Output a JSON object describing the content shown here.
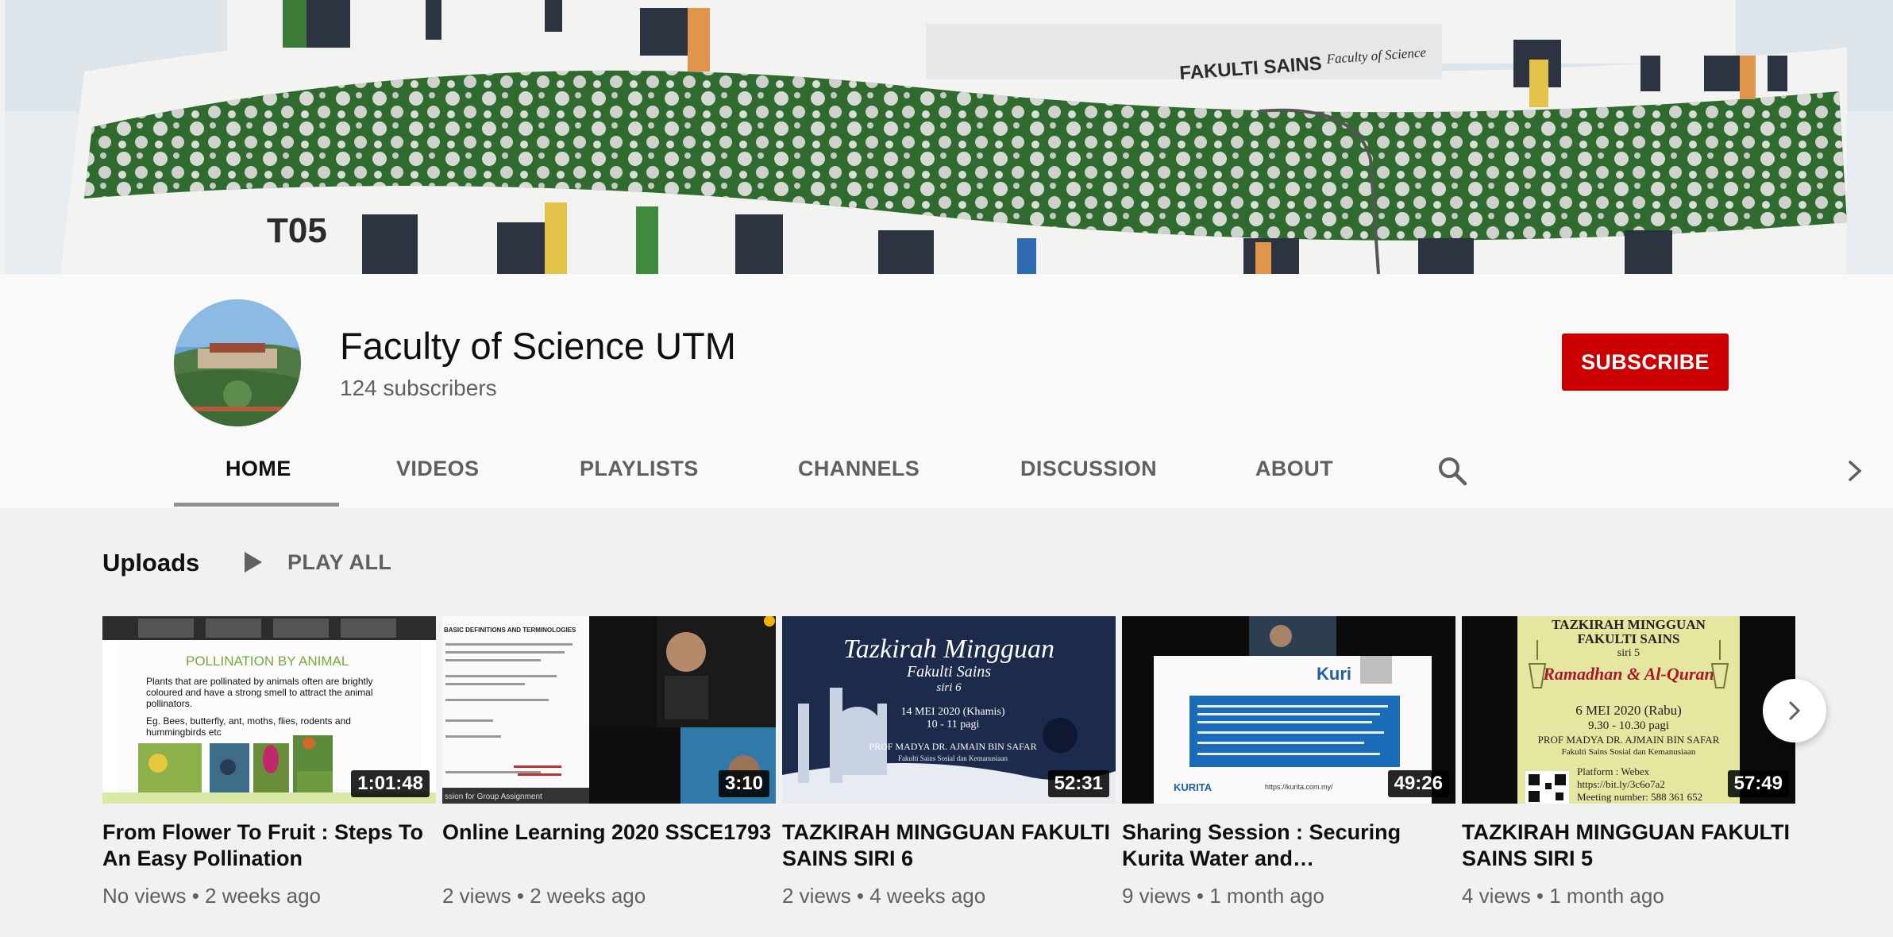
{
  "banner": {
    "building_code": "T05",
    "sign_text": "FAKULTI SAINS  Faculty of Science"
  },
  "channel": {
    "name": "Faculty of Science UTM",
    "subscribers": "124 subscribers",
    "subscribe_label": "SUBSCRIBE"
  },
  "tabs": [
    {
      "label": "HOME",
      "active": true
    },
    {
      "label": "VIDEOS",
      "active": false
    },
    {
      "label": "PLAYLISTS",
      "active": false
    },
    {
      "label": "CHANNELS",
      "active": false
    },
    {
      "label": "DISCUSSION",
      "active": false
    },
    {
      "label": "ABOUT",
      "active": false
    }
  ],
  "icons": {
    "search": "search-icon",
    "tabs_next": "chevron-right-icon",
    "play": "play-icon",
    "carousel_next": "chevron-right-icon"
  },
  "uploads": {
    "title": "Uploads",
    "play_all_label": "PLAY ALL",
    "videos": [
      {
        "title": "From Flower To Fruit : Steps To An Easy Pollination",
        "meta": "No views • 2 weeks ago",
        "duration": "1:01:48",
        "thumb_text": {
          "heading": "POLLINATION BY ANIMAL",
          "b1": "Plants that are pollinated by animals often are brightly",
          "b1b": "coloured and have a strong smell to attract the animal",
          "b1c": "pollinators.",
          "b2": "Eg. Bees, butterfly, ant, moths, flies, rodents and",
          "b2b": "hummingbirds etc"
        }
      },
      {
        "title": "Online Learning 2020 SSCE1793",
        "meta": "2 views • 2 weeks ago",
        "duration": "3:10",
        "thumb_text": {
          "heading": "BASIC DEFINITIONS AND TERMINOLOGIES",
          "footer": "ssion for Group Assignment"
        }
      },
      {
        "title": "TAZKIRAH MINGGUAN FAKULTI SAINS SIRI 6",
        "meta": "2 views • 4 weeks ago",
        "duration": "52:31",
        "thumb_text": {
          "l1": "Tazkirah Mingguan",
          "l2": "Fakulti Sains",
          "l3": "siri 6",
          "l4": "14 MEI 2020 (Khamis)",
          "l5": "10 - 11 pagi",
          "l6": "PROF MADYA DR. AJMAIN BIN SAFAR",
          "l7": "Fakulti Sains Sosial dan Kemanusiaan"
        }
      },
      {
        "title": "Sharing Session : Securing Kurita Water and…",
        "meta": "9 views • 1 month ago",
        "duration": "49:26",
        "thumb_text": {
          "logo": "Kuri",
          "url": "https://kurita.com.my/",
          "logo2": "KURITA"
        }
      },
      {
        "title": "TAZKIRAH MINGGUAN FAKULTI SAINS SIRI 5",
        "meta": "4 views • 1 month ago",
        "duration": "57:49",
        "thumb_text": {
          "l1": "TAZKIRAH MINGGUAN",
          "l2": "FAKULTI SAINS",
          "l3": "siri 5",
          "l4": "Ramadhan & Al-Quran",
          "l5": "6 MEI 2020 (Rabu)",
          "l6": "9.30 - 10.30 pagi",
          "l7": "PROF MADYA DR. AJMAIN BIN SAFAR",
          "l8": "Fakulti Sains Sosial dan Kemanusiaan",
          "l9": "Platform : Webex",
          "l10": "https://bit.ly/3c6o7a2",
          "l11": "Meeting number: 588 361 652"
        }
      }
    ]
  }
}
